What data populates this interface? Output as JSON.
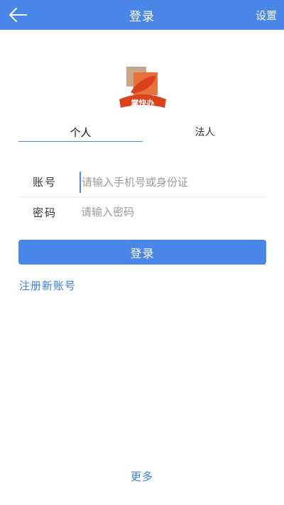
{
  "header": {
    "title": "登录",
    "settings_label": "设置",
    "back_icon": "arrow-left-icon",
    "background_color": "#4a86e8"
  },
  "logo": {
    "text": "掌快办"
  },
  "tabs": [
    {
      "label": "个人",
      "active": true
    },
    {
      "label": "法人",
      "active": false
    }
  ],
  "form": {
    "account": {
      "label": "账号",
      "placeholder": "请输入手机号或身份证",
      "value": ""
    },
    "password": {
      "label": "密码",
      "placeholder": "请输入密码",
      "value": ""
    }
  },
  "login_button": {
    "label": "登录"
  },
  "register_link": {
    "label": "注册新账号"
  },
  "more_link": {
    "label": "更多"
  },
  "colors": {
    "accent": "#4a86e8",
    "link": "#3b7ee0",
    "logo_orange": "#e8733a",
    "logo_red": "#d9421c"
  }
}
